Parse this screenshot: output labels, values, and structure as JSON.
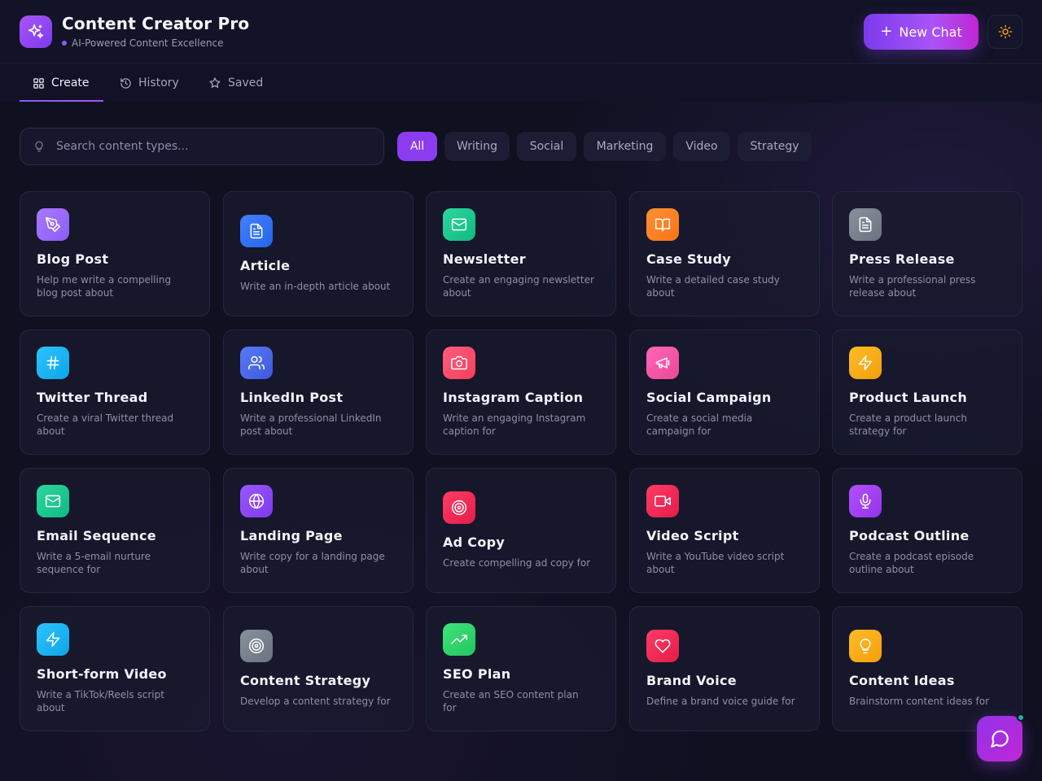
{
  "header": {
    "title": "Content Creator Pro",
    "subtitle": "AI-Powered Content Excellence",
    "new_chat_label": "New Chat"
  },
  "tabs": [
    {
      "label": "Create",
      "icon": "grid-icon",
      "active": true
    },
    {
      "label": "History",
      "icon": "history-icon",
      "active": false
    },
    {
      "label": "Saved",
      "icon": "star-icon",
      "active": false
    }
  ],
  "search": {
    "placeholder": "Search content types...",
    "value": ""
  },
  "filters": [
    {
      "label": "All",
      "active": true
    },
    {
      "label": "Writing",
      "active": false
    },
    {
      "label": "Social",
      "active": false
    },
    {
      "label": "Marketing",
      "active": false
    },
    {
      "label": "Video",
      "active": false
    },
    {
      "label": "Strategy",
      "active": false
    }
  ],
  "cards": [
    {
      "title": "Blog Post",
      "desc": "Help me write a compelling blog post about",
      "icon": "pen-tool-icon",
      "color": "#8b5cf6"
    },
    {
      "title": "Article",
      "desc": "Write an in-depth article about",
      "icon": "document-icon",
      "color": "#2563eb"
    },
    {
      "title": "Newsletter",
      "desc": "Create an engaging newsletter about",
      "icon": "mail-icon",
      "color": "#10b981"
    },
    {
      "title": "Case Study",
      "desc": "Write a detailed case study about",
      "icon": "book-open-icon",
      "color": "#f97316"
    },
    {
      "title": "Press Release",
      "desc": "Write a professional press release about",
      "icon": "document-icon",
      "color": "#6b7280"
    },
    {
      "title": "Twitter Thread",
      "desc": "Create a viral Twitter thread about",
      "icon": "hash-icon",
      "color": "#0ea5e9"
    },
    {
      "title": "LinkedIn Post",
      "desc": "Write a professional LinkedIn post about",
      "icon": "users-icon",
      "color": "#3b5bdb"
    },
    {
      "title": "Instagram Caption",
      "desc": "Write an engaging Instagram caption for",
      "icon": "camera-icon",
      "color": "#f43f5e"
    },
    {
      "title": "Social Campaign",
      "desc": "Create a social media campaign for",
      "icon": "megaphone-icon",
      "color": "#ec4899"
    },
    {
      "title": "Product Launch",
      "desc": "Create a product launch strategy for",
      "icon": "zap-icon",
      "color": "#f59e0b"
    },
    {
      "title": "Email Sequence",
      "desc": "Write a 5-email nurture sequence for",
      "icon": "mail-icon",
      "color": "#10b981"
    },
    {
      "title": "Landing Page",
      "desc": "Write copy for a landing page about",
      "icon": "globe-icon",
      "color": "#7c3aed"
    },
    {
      "title": "Ad Copy",
      "desc": "Create compelling ad copy for",
      "icon": "target-icon",
      "color": "#e11d48"
    },
    {
      "title": "Video Script",
      "desc": "Write a YouTube video script about",
      "icon": "video-icon",
      "color": "#e11d48"
    },
    {
      "title": "Podcast Outline",
      "desc": "Create a podcast episode outline about",
      "icon": "mic-icon",
      "color": "#9333ea"
    },
    {
      "title": "Short-form Video",
      "desc": "Write a TikTok/Reels script about",
      "icon": "zap-icon",
      "color": "#0ea5e9"
    },
    {
      "title": "Content Strategy",
      "desc": "Develop a content strategy for",
      "icon": "target-icon",
      "color": "#6b7280"
    },
    {
      "title": "SEO Plan",
      "desc": "Create an SEO content plan for",
      "icon": "trending-up-icon",
      "color": "#22c55e"
    },
    {
      "title": "Brand Voice",
      "desc": "Define a brand voice guide for",
      "icon": "heart-icon",
      "color": "#e11d48"
    },
    {
      "title": "Content Ideas",
      "desc": "Brainstorm content ideas for",
      "icon": "lightbulb-icon",
      "color": "#f59e0b"
    }
  ]
}
